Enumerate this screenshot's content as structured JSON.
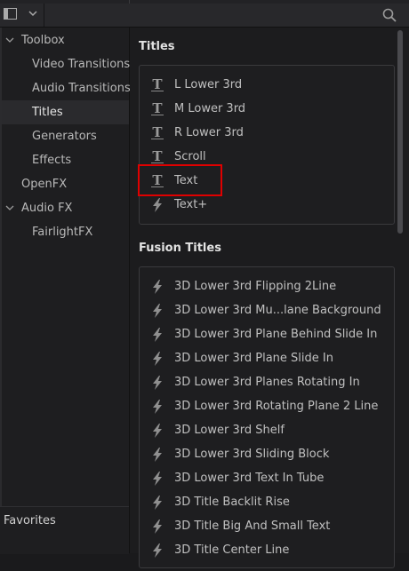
{
  "toolbar": {
    "panel_toggle_icon": "panel-toggle-icon",
    "dropdown_icon": "chevron-down-icon",
    "search_icon": "search-icon"
  },
  "sidebar": {
    "items": [
      {
        "label": "Toolbox",
        "expanded": true
      },
      {
        "label": "Video Transitions"
      },
      {
        "label": "Audio Transitions"
      },
      {
        "label": "Titles",
        "selected": true
      },
      {
        "label": "Generators"
      },
      {
        "label": "Effects"
      },
      {
        "label": "OpenFX"
      },
      {
        "label": "Audio FX",
        "expanded": true
      },
      {
        "label": "FairlightFX"
      }
    ],
    "favorites_label": "Favorites"
  },
  "titles": {
    "heading": "Titles",
    "items": [
      {
        "label": "L Lower 3rd",
        "icon": "text-t-icon"
      },
      {
        "label": "M Lower 3rd",
        "icon": "text-t-icon"
      },
      {
        "label": "R Lower 3rd",
        "icon": "text-t-icon"
      },
      {
        "label": "Scroll",
        "icon": "text-t-icon"
      },
      {
        "label": "Text",
        "icon": "text-t-icon",
        "highlighted": true
      },
      {
        "label": "Text+",
        "icon": "fusion-bolt-icon"
      }
    ]
  },
  "fusion_titles": {
    "heading": "Fusion Titles",
    "items": [
      {
        "label": "3D Lower 3rd Flipping 2Line"
      },
      {
        "label": "3D Lower 3rd Mu...lane Background"
      },
      {
        "label": "3D Lower 3rd Plane Behind Slide In"
      },
      {
        "label": "3D Lower 3rd Plane Slide In"
      },
      {
        "label": "3D Lower 3rd Planes Rotating In"
      },
      {
        "label": "3D Lower 3rd Rotating Plane 2 Line"
      },
      {
        "label": "3D Lower 3rd Shelf"
      },
      {
        "label": "3D Lower 3rd Sliding Block"
      },
      {
        "label": "3D Lower 3rd Text In Tube"
      },
      {
        "label": "3D Title Backlit Rise"
      },
      {
        "label": "3D Title Big And Small Text"
      },
      {
        "label": "3D Title Center Line"
      }
    ]
  },
  "colors": {
    "highlight_border": "#e00000"
  }
}
